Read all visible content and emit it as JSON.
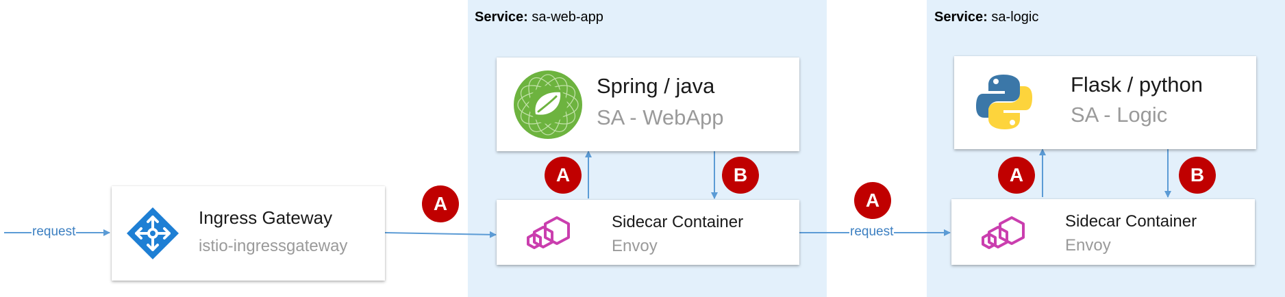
{
  "colors": {
    "service_bg": "#e3f0fb",
    "arrow": "#5b9bd5",
    "badge": "#c00000",
    "spring_green": "#6db33f",
    "envoy_magenta": "#ca3eae",
    "gateway_blue": "#1e7fd4"
  },
  "services": [
    {
      "prefix": "Service:",
      "name": "sa-web-app"
    },
    {
      "prefix": "Service:",
      "name": "sa-logic"
    }
  ],
  "ingress": {
    "title": "Ingress Gateway",
    "subtitle": "istio-ingressgateway",
    "icon": "gateway-icon"
  },
  "web_app": {
    "title": "Spring / java",
    "subtitle": "SA - WebApp",
    "icon": "spring-icon"
  },
  "web_sidecar": {
    "title": "Sidecar Container",
    "subtitle": "Envoy",
    "icon": "envoy-icon"
  },
  "logic_app": {
    "title": "Flask / python",
    "subtitle": "SA - Logic",
    "icon": "python-icon"
  },
  "logic_sidecar": {
    "title": "Sidecar Container",
    "subtitle": "Envoy",
    "icon": "envoy-icon"
  },
  "labels": {
    "request": "request",
    "a": "A",
    "b": "B"
  }
}
